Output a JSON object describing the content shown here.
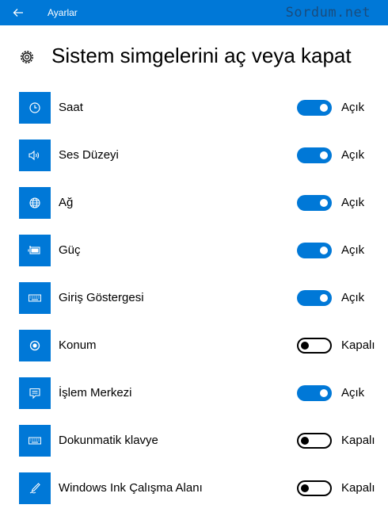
{
  "titlebar": {
    "back_icon": "back-arrow-icon",
    "title": "Ayarlar",
    "watermark": "Sordum.net"
  },
  "header": {
    "icon": "gear-icon",
    "title": "Sistem simgelerini aç veya kapat"
  },
  "items": [
    {
      "label": "Saat",
      "icon": "clock-icon",
      "on": true,
      "state": "Açık"
    },
    {
      "label": "Ses Düzeyi",
      "icon": "speaker-icon",
      "on": true,
      "state": "Açık"
    },
    {
      "label": "Ağ",
      "icon": "globe-icon",
      "on": true,
      "state": "Açık"
    },
    {
      "label": "Güç",
      "icon": "battery-icon",
      "on": true,
      "state": "Açık"
    },
    {
      "label": "Giriş Göstergesi",
      "icon": "keyboard-icon",
      "on": true,
      "state": "Açık"
    },
    {
      "label": "Konum",
      "icon": "location-icon",
      "on": false,
      "state": "Kapalı"
    },
    {
      "label": "İşlem Merkezi",
      "icon": "action-center-icon",
      "on": true,
      "state": "Açık"
    },
    {
      "label": "Dokunmatik klavye",
      "icon": "touch-keyboard-icon",
      "on": false,
      "state": "Kapalı"
    },
    {
      "label": "Windows Ink Çalışma Alanı",
      "icon": "pen-icon",
      "on": false,
      "state": "Kapalı"
    }
  ],
  "colors": {
    "accent": "#0078d7",
    "background": "#ffffff",
    "text": "#000000"
  }
}
